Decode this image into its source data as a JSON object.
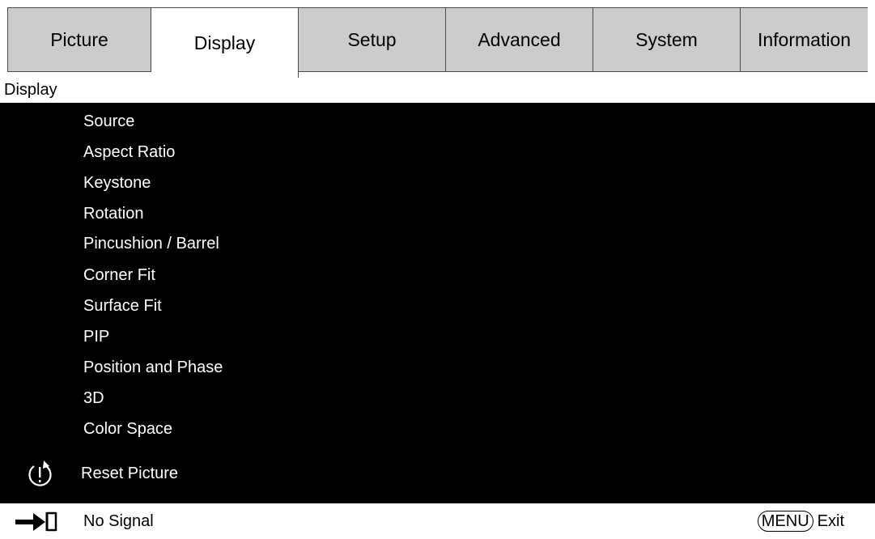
{
  "tabs": [
    {
      "label": "Picture"
    },
    {
      "label": "Display"
    },
    {
      "label": "Setup"
    },
    {
      "label": "Advanced"
    },
    {
      "label": "System"
    },
    {
      "label": "Information"
    }
  ],
  "active_tab": "Display",
  "section_header": "Display",
  "menu_items": [
    {
      "label": "Source"
    },
    {
      "label": "Aspect Ratio"
    },
    {
      "label": "Keystone"
    },
    {
      "label": "Rotation"
    },
    {
      "label": "Pincushion / Barrel"
    },
    {
      "label": "Corner Fit"
    },
    {
      "label": "Surface Fit"
    },
    {
      "label": "PIP"
    },
    {
      "label": "Position and Phase"
    },
    {
      "label": "3D"
    },
    {
      "label": "Color Space"
    }
  ],
  "reset": {
    "label": "Reset Picture",
    "icon": "reset-icon"
  },
  "status": {
    "input_icon": "input-source-icon",
    "signal_text": "No Signal",
    "menu_key": "MENU",
    "exit_label": "Exit"
  },
  "colors": {
    "tab_inactive": "#cccccc",
    "tab_active": "#ffffff",
    "menu_bg": "#000000",
    "menu_text": "#ffffff"
  }
}
